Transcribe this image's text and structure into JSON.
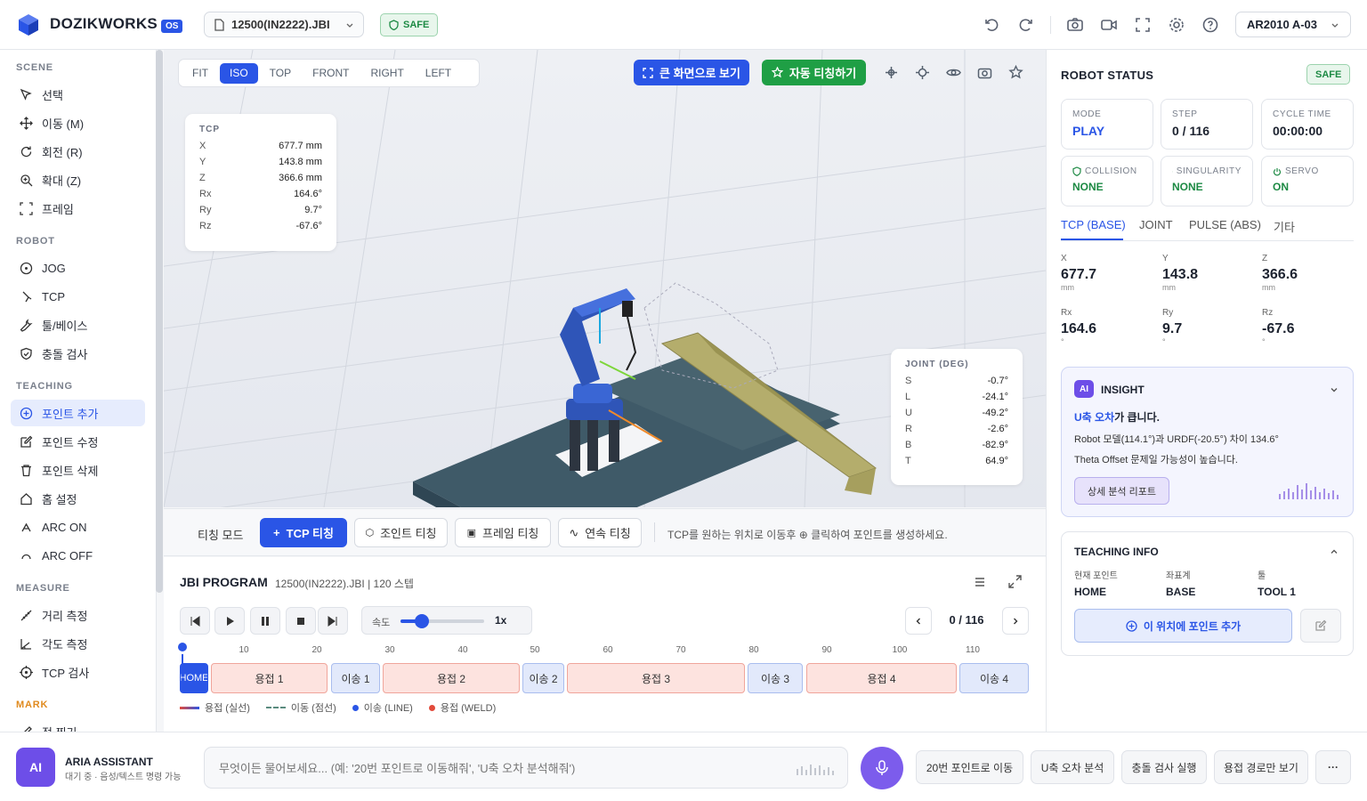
{
  "header": {
    "brand": "DOZIKWORKS",
    "os_badge": "OS",
    "file_name": "12500(IN2222).JBI",
    "safe_label": "SAFE",
    "robot_model": "AR2010 A-03",
    "icons": [
      "undo-icon",
      "redo-icon",
      "camera-icon",
      "video-icon",
      "fullscreen-icon",
      "gear-icon",
      "help-icon"
    ]
  },
  "sidebar": {
    "sections": [
      {
        "title": "SCENE",
        "items": [
          "선택",
          "이동 (M)",
          "회전 (R)",
          "확대 (Z)",
          "프레임"
        ]
      },
      {
        "title": "ROBOT",
        "items": [
          "JOG",
          "TCP",
          "툴/베이스",
          "충돌 검사"
        ]
      },
      {
        "title": "TEACHING",
        "items": [
          "포인트 추가",
          "포인트 수정",
          "포인트 삭제",
          "홈 설정",
          "ARC ON",
          "ARC OFF"
        ],
        "active": "포인트 추가"
      },
      {
        "title": "MEASURE",
        "items": [
          "거리 측정",
          "각도 측정",
          "TCP 검사"
        ]
      },
      {
        "title": "MARK",
        "items": [
          "점 찍기"
        ]
      }
    ]
  },
  "viewport": {
    "views": [
      "FIT",
      "ISO",
      "TOP",
      "FRONT",
      "RIGHT",
      "LEFT"
    ],
    "active_view": "ISO",
    "fullscreen_btn": "큰 화면으로 보기",
    "auto_teach_btn": "자동 티칭하기",
    "tcp_card": {
      "title": "TCP",
      "rows": [
        {
          "k": "X",
          "v": "677.7 mm"
        },
        {
          "k": "Y",
          "v": "143.8 mm"
        },
        {
          "k": "Z",
          "v": "366.6 mm"
        },
        {
          "k": "Rx",
          "v": "164.6°"
        },
        {
          "k": "Ry",
          "v": "9.7°"
        },
        {
          "k": "Rz",
          "v": "-67.6°"
        }
      ]
    },
    "joint_card": {
      "title": "JOINT (DEG)",
      "rows": [
        {
          "k": "S",
          "v": "-0.7°"
        },
        {
          "k": "L",
          "v": "-24.1°"
        },
        {
          "k": "U",
          "v": "-49.2°"
        },
        {
          "k": "R",
          "v": "-2.6°"
        },
        {
          "k": "B",
          "v": "-82.9°"
        },
        {
          "k": "T",
          "v": "64.9°"
        }
      ]
    }
  },
  "teachbar": {
    "label": "티칭 모드",
    "buttons": [
      "TCP 티칭",
      "조인트 티칭",
      "프레임 티칭",
      "연속 티칭"
    ],
    "active": "TCP 티칭",
    "hint": "TCP를 원하는 위치로 이동후 ⊕ 클릭하여 포인트를 생성하세요."
  },
  "program": {
    "title": "JBI PROGRAM",
    "subtitle": "12500(IN2222).JBI | 120 스텝",
    "speed_label": "속도",
    "speed_value": "1x",
    "speed_fraction": 0.25,
    "step_counter": "0 / 116",
    "ticks": [
      "10",
      "20",
      "30",
      "40",
      "50",
      "60",
      "70",
      "80",
      "90",
      "100",
      "110"
    ],
    "segments": [
      {
        "label": "HOME",
        "type": "home"
      },
      {
        "label": "용접 1",
        "type": "weld"
      },
      {
        "label": "이송 1",
        "type": "move"
      },
      {
        "label": "용접 2",
        "type": "weld"
      },
      {
        "label": "이송 2",
        "type": "move"
      },
      {
        "label": "용접 3",
        "type": "weld"
      },
      {
        "label": "이송 3",
        "type": "move"
      },
      {
        "label": "용접 4",
        "type": "weld"
      },
      {
        "label": "이송 4",
        "type": "move"
      }
    ],
    "legend": [
      "용접 (실선)",
      "이동 (점선)",
      "이송 (LINE)",
      "용접 (WELD)"
    ]
  },
  "right": {
    "title": "ROBOT STATUS",
    "safe": "SAFE",
    "status": [
      {
        "label": "MODE",
        "value": "PLAY"
      },
      {
        "label": "STEP",
        "value": "0 / 116"
      },
      {
        "label": "CYCLE TIME",
        "value": "00:00:00"
      },
      {
        "label": "COLLISION",
        "value": "NONE"
      },
      {
        "label": "SINGULARITY",
        "value": "NONE"
      },
      {
        "label": "SERVO",
        "value": "ON"
      }
    ],
    "tabs": [
      "TCP (BASE)",
      "JOINT",
      "PULSE (ABS)",
      "기타"
    ],
    "coords": [
      {
        "label": "X",
        "value": "677.7",
        "unit": "mm"
      },
      {
        "label": "Y",
        "value": "143.8",
        "unit": "mm"
      },
      {
        "label": "Z",
        "value": "366.6",
        "unit": "mm"
      },
      {
        "label": "Rx",
        "value": "164.6",
        "unit": "°"
      },
      {
        "label": "Ry",
        "value": "9.7",
        "unit": "°"
      },
      {
        "label": "Rz",
        "value": "-67.6",
        "unit": "°"
      }
    ],
    "insight": {
      "badge": "AI",
      "title": "INSIGHT",
      "headline_strong": "U축 오차",
      "headline_rest": "가 큽니다.",
      "line1": "Robot 모델(114.1°)과 URDF(-20.5°) 차이 134.6°",
      "line2": "Theta Offset 문제일 가능성이 높습니다.",
      "report_btn": "상세 분석 리포트"
    },
    "teaching_info": {
      "title": "TEACHING INFO",
      "fields": [
        {
          "label": "현재 포인트",
          "value": "HOME"
        },
        {
          "label": "좌표계",
          "value": "BASE"
        },
        {
          "label": "툴",
          "value": "TOOL 1"
        }
      ],
      "add_btn": "이 위치에 포인트 추가"
    }
  },
  "assistant": {
    "avatar": "AI",
    "name": "ARIA ASSISTANT",
    "status": "대기 중 · 음성/텍스트 명령 가능",
    "placeholder": "무엇이든 물어보세요... (예: '20번 포인트로 이동해줘', 'U축 오차 분석해줘')",
    "quick": [
      "20번 포인트로 이동",
      "U축 오차 분석",
      "충돌 검사 실행",
      "용접 경로만 보기"
    ],
    "more": "···"
  },
  "colors": {
    "accent": "#2a55e6",
    "green": "#1f9f45",
    "robot": "#2f55b8",
    "weld_fill": "#fde3df",
    "move_fill": "#e2e9fb"
  }
}
